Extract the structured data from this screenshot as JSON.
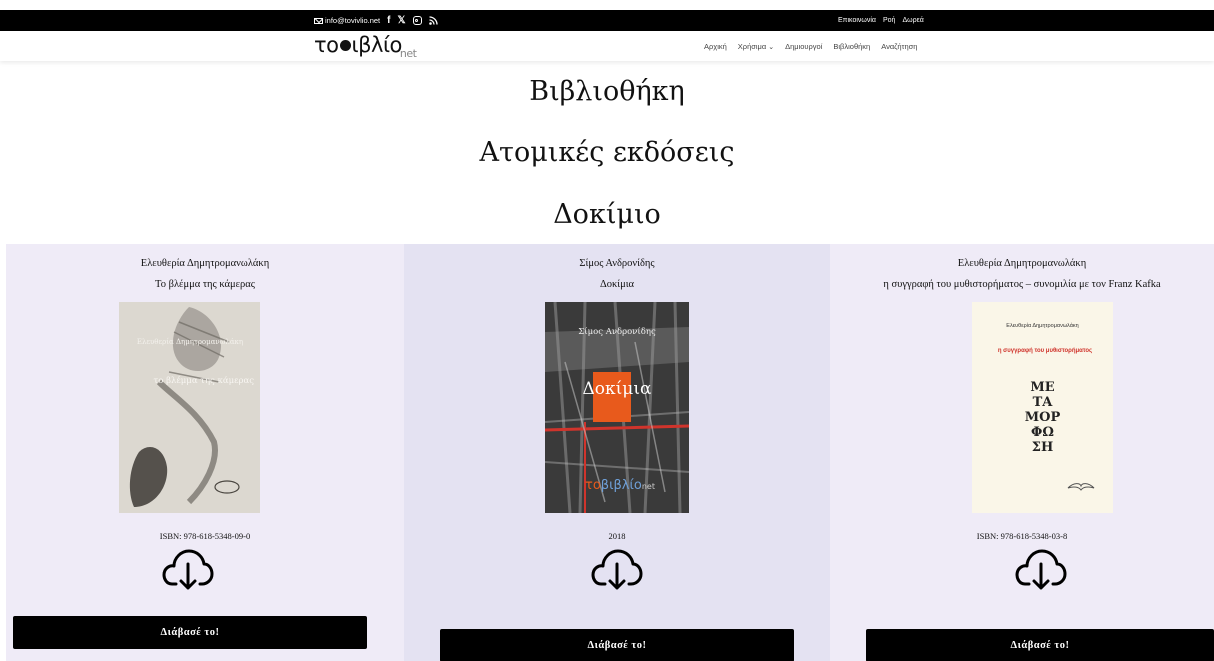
{
  "topbar": {
    "email": "info@tovivlio.net",
    "social_icons": [
      "facebook-icon",
      "x-icon",
      "instagram-icon",
      "rss-icon"
    ],
    "links": [
      "Επικοινωνία",
      "Ροή",
      "Δωρεά"
    ]
  },
  "header": {
    "logo_text": "το βιβλίο",
    "logo_suffix": "net",
    "nav": [
      "Αρχική",
      "Χρήσιμα",
      "Δημιουργοί",
      "Βιβλιοθήκη",
      "Αναζήτηση"
    ]
  },
  "page": {
    "title": "Βιβλιοθήκη",
    "subtitle": "Ατομικές εκδόσεις",
    "section": "Δοκίμιο"
  },
  "books": [
    {
      "author": "Ελευθερία Δημητρομανωλάκη",
      "title": "Το βλέμμα της κάμερας",
      "cover_author": "Ελευθερία Δημητρομανωλάκη",
      "cover_title": "το βλέμμα της κάμερας",
      "meta": "ISBN: 978-618-5348-09-0",
      "button": "Διάβασέ το!"
    },
    {
      "author": "Σίμος Ανδρονίδης",
      "title": "Δοκίμια",
      "cover_author": "Σίμος Ανδρονίδης",
      "cover_title": "Δοκίμια",
      "meta": "2018",
      "button": "Διάβασέ το!"
    },
    {
      "author": "Ελευθερία Δημητρομανωλάκη",
      "title": "η συγγραφή του μυθιστορήματος – συνομιλία με τον Franz Kafka",
      "cover_author": "Ελευθερία Δημητρομανωλάκη",
      "cover_title": "η συγγραφή του μυθιστορήματος",
      "cover_art": [
        "ΜΕ",
        "ΤΑ",
        "ΜΟΡ",
        "ΦΩ",
        "ΣΗ"
      ],
      "meta": "ISBN: 978-618-5348-03-8",
      "button": "Διάβασέ το!"
    }
  ],
  "colors": {
    "topbar": "#000000",
    "card_light": "#efebf7",
    "card_mid": "#e4e2f2",
    "button": "#000000",
    "accent_orange": "#e85a1c",
    "accent_red": "#d0342c"
  }
}
